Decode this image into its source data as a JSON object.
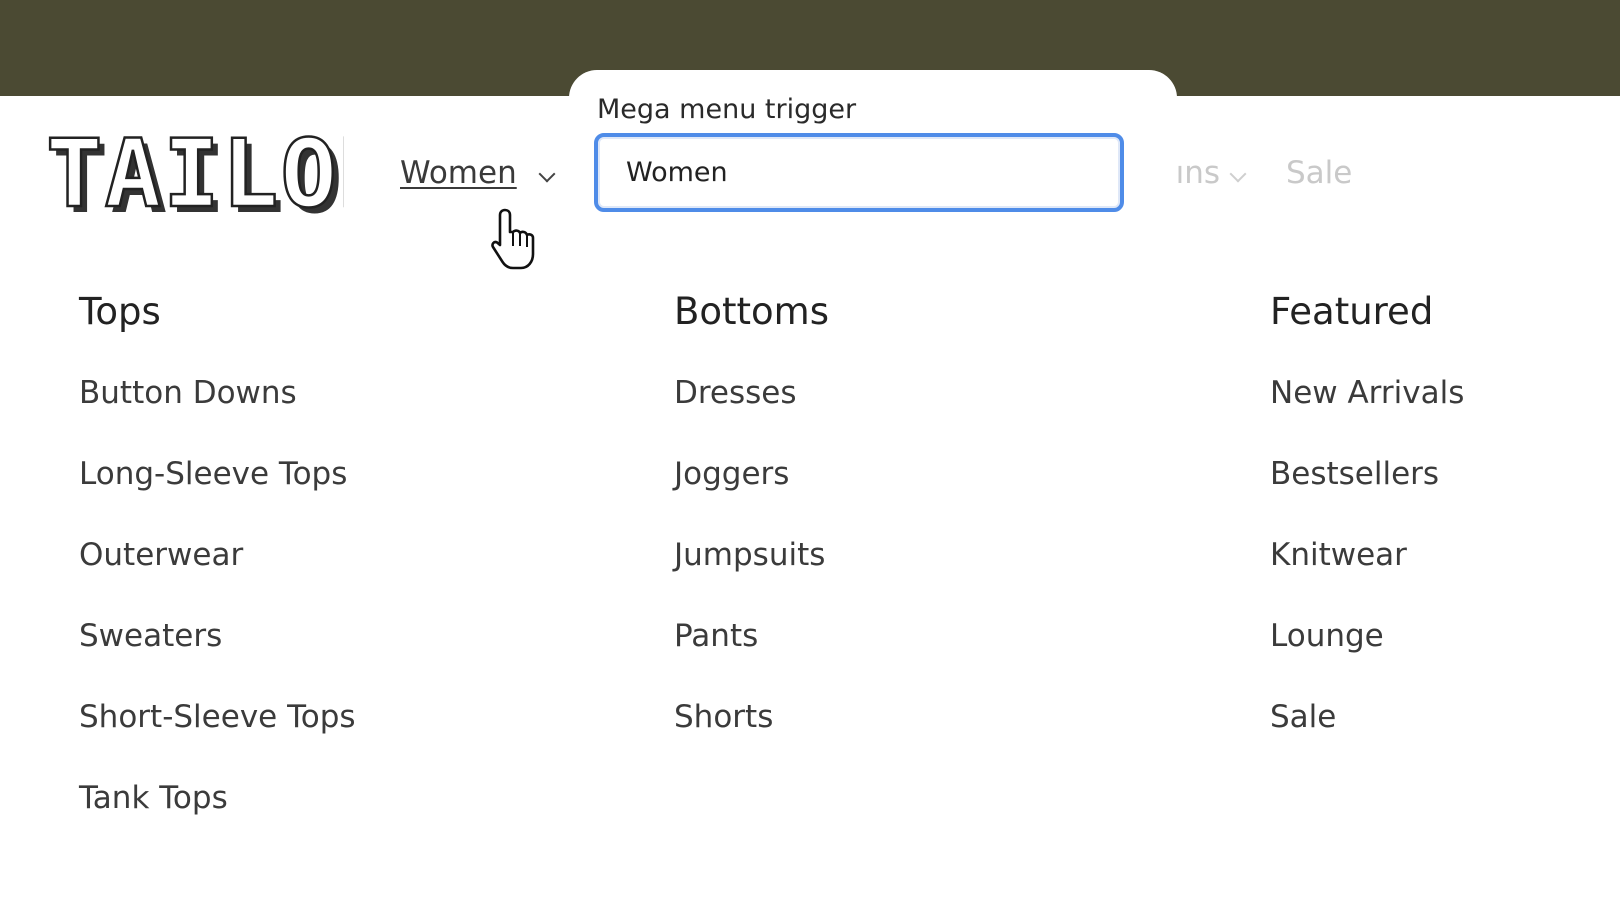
{
  "brand": {
    "logo_text": "TAILOR"
  },
  "nav": {
    "women_label": "Women",
    "partial_label": "ıns",
    "sale_label": "Sale"
  },
  "popover": {
    "label": "Mega menu trigger",
    "input_value": "Women"
  },
  "menu": {
    "columns": [
      {
        "heading": "Tops",
        "items": [
          "Button Downs",
          "Long-Sleeve Tops",
          "Outerwear",
          "Sweaters",
          "Short-Sleeve Tops",
          "Tank Tops"
        ]
      },
      {
        "heading": "Bottoms",
        "items": [
          "Dresses",
          "Joggers",
          "Jumpsuits",
          "Pants",
          "Shorts"
        ]
      },
      {
        "heading": "Featured",
        "items": [
          "New Arrivals",
          "Bestsellers",
          "Knitwear",
          "Lounge",
          "Sale"
        ]
      }
    ]
  },
  "colors": {
    "topbar": "#4b4a33",
    "focus_ring": "#4f8ce8",
    "text": "#3b3b3b",
    "faded_text": "#c9c9c9"
  },
  "icons": {
    "nav_chevron": "chevron-down-icon",
    "cursor": "hand-pointer-icon"
  }
}
